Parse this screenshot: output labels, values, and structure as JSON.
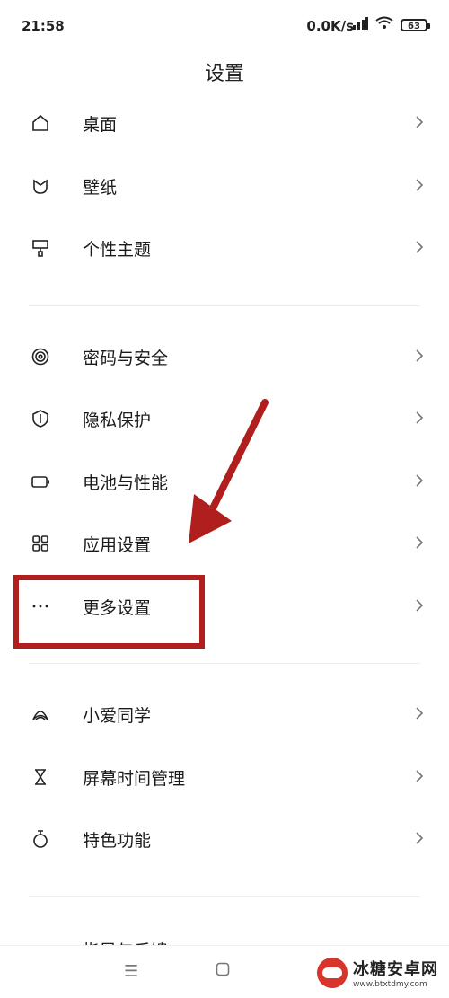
{
  "status_bar": {
    "time": "21:58",
    "net_speed": "0.0K/s",
    "battery": "63"
  },
  "header": {
    "title": "设置"
  },
  "groups": [
    [
      {
        "label": "桌面",
        "icon": "home-icon"
      },
      {
        "label": "壁纸",
        "icon": "wallpaper-icon"
      },
      {
        "label": "个性主题",
        "icon": "theme-brush-icon"
      }
    ],
    [
      {
        "label": "密码与安全",
        "icon": "fingerprint-icon"
      },
      {
        "label": "隐私保护",
        "icon": "privacy-shield-icon"
      },
      {
        "label": "电池与性能",
        "icon": "battery-icon"
      },
      {
        "label": "应用设置",
        "icon": "apps-grid-icon"
      },
      {
        "label": "更多设置",
        "icon": "more-dots-icon"
      }
    ],
    [
      {
        "label": "小爱同学",
        "icon": "assistant-icon"
      },
      {
        "label": "屏幕时间管理",
        "icon": "hourglass-icon"
      },
      {
        "label": "特色功能",
        "icon": "features-icon"
      }
    ]
  ],
  "partial_row": {
    "label": "指导与反馈"
  },
  "watermark": {
    "name": "冰糖安卓网",
    "url": "www.btxtdmy.com"
  }
}
